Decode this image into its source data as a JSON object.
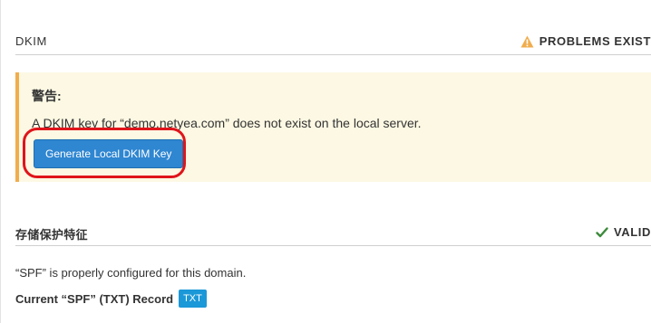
{
  "dkim": {
    "title": "DKIM",
    "status_label": "PROBLEMS EXIST",
    "status_icon": "warning-icon",
    "status_color": "#f0ad4e",
    "warning": {
      "title": "警告:",
      "message": "A DKIM key for “demo.netyea.com” does not exist on the local server.",
      "background": "#fcf8e3"
    },
    "generate_button_label": "Generate Local DKIM Key",
    "button_color": "#2f86d1",
    "highlight_color": "#e0141b"
  },
  "spf": {
    "title": "存储保护特征",
    "status_label": "VALID",
    "status_icon": "checkmark-icon",
    "status_color": "#3c8a3c",
    "message": "“SPF” is properly configured for this domain.",
    "record_label": "Current “SPF” (TXT) Record",
    "record_badge": "TXT",
    "badge_color": "#1b98d8"
  }
}
